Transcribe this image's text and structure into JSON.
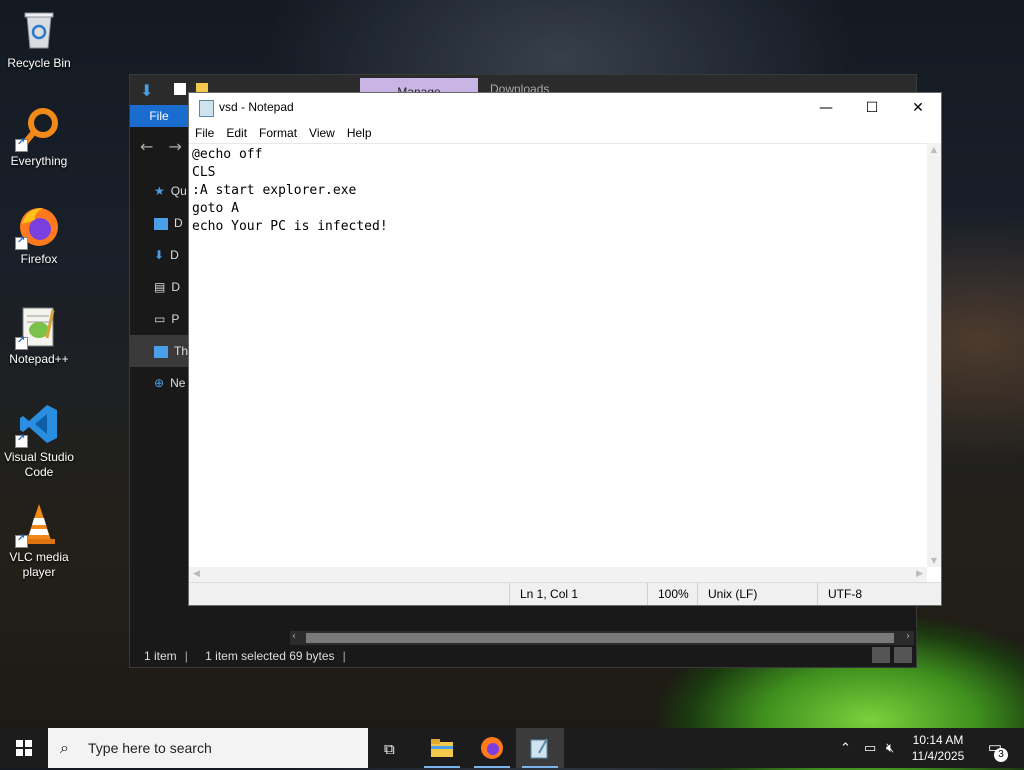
{
  "desktop": {
    "icons": [
      {
        "label": "Recycle Bin"
      },
      {
        "label": "Everything"
      },
      {
        "label": "Firefox"
      },
      {
        "label": "Notepad++"
      },
      {
        "label": "Visual Studio Code"
      },
      {
        "label": "VLC media player"
      }
    ]
  },
  "explorer": {
    "ribbon_context_tab": "Manage",
    "title": "Downloads",
    "file_tab": "File",
    "sidebar": [
      "Qu",
      "D",
      "D",
      "D",
      "P",
      "Th",
      "Ne"
    ],
    "status": {
      "items": "1 item",
      "selected": "1 item selected  69 bytes"
    }
  },
  "notepad": {
    "title": "vsd - Notepad",
    "menu": [
      "File",
      "Edit",
      "Format",
      "View",
      "Help"
    ],
    "content": "@echo off\nCLS\n:A start explorer.exe\ngoto A\necho Your PC is infected!",
    "status": {
      "position": "Ln 1, Col 1",
      "zoom": "100%",
      "line_ending": "Unix (LF)",
      "encoding": "UTF-8"
    },
    "controls": {
      "minimize": "—",
      "maximize": "☐",
      "close": "✕"
    }
  },
  "taskbar": {
    "search_placeholder": "Type here to search",
    "time": "10:14 AM",
    "date": "11/4/2025",
    "notifications": "3"
  },
  "colors": {
    "accent": "#1a6ccf",
    "taskbar": "#1c1c1c",
    "manage_tab": "#c9b4e6"
  }
}
